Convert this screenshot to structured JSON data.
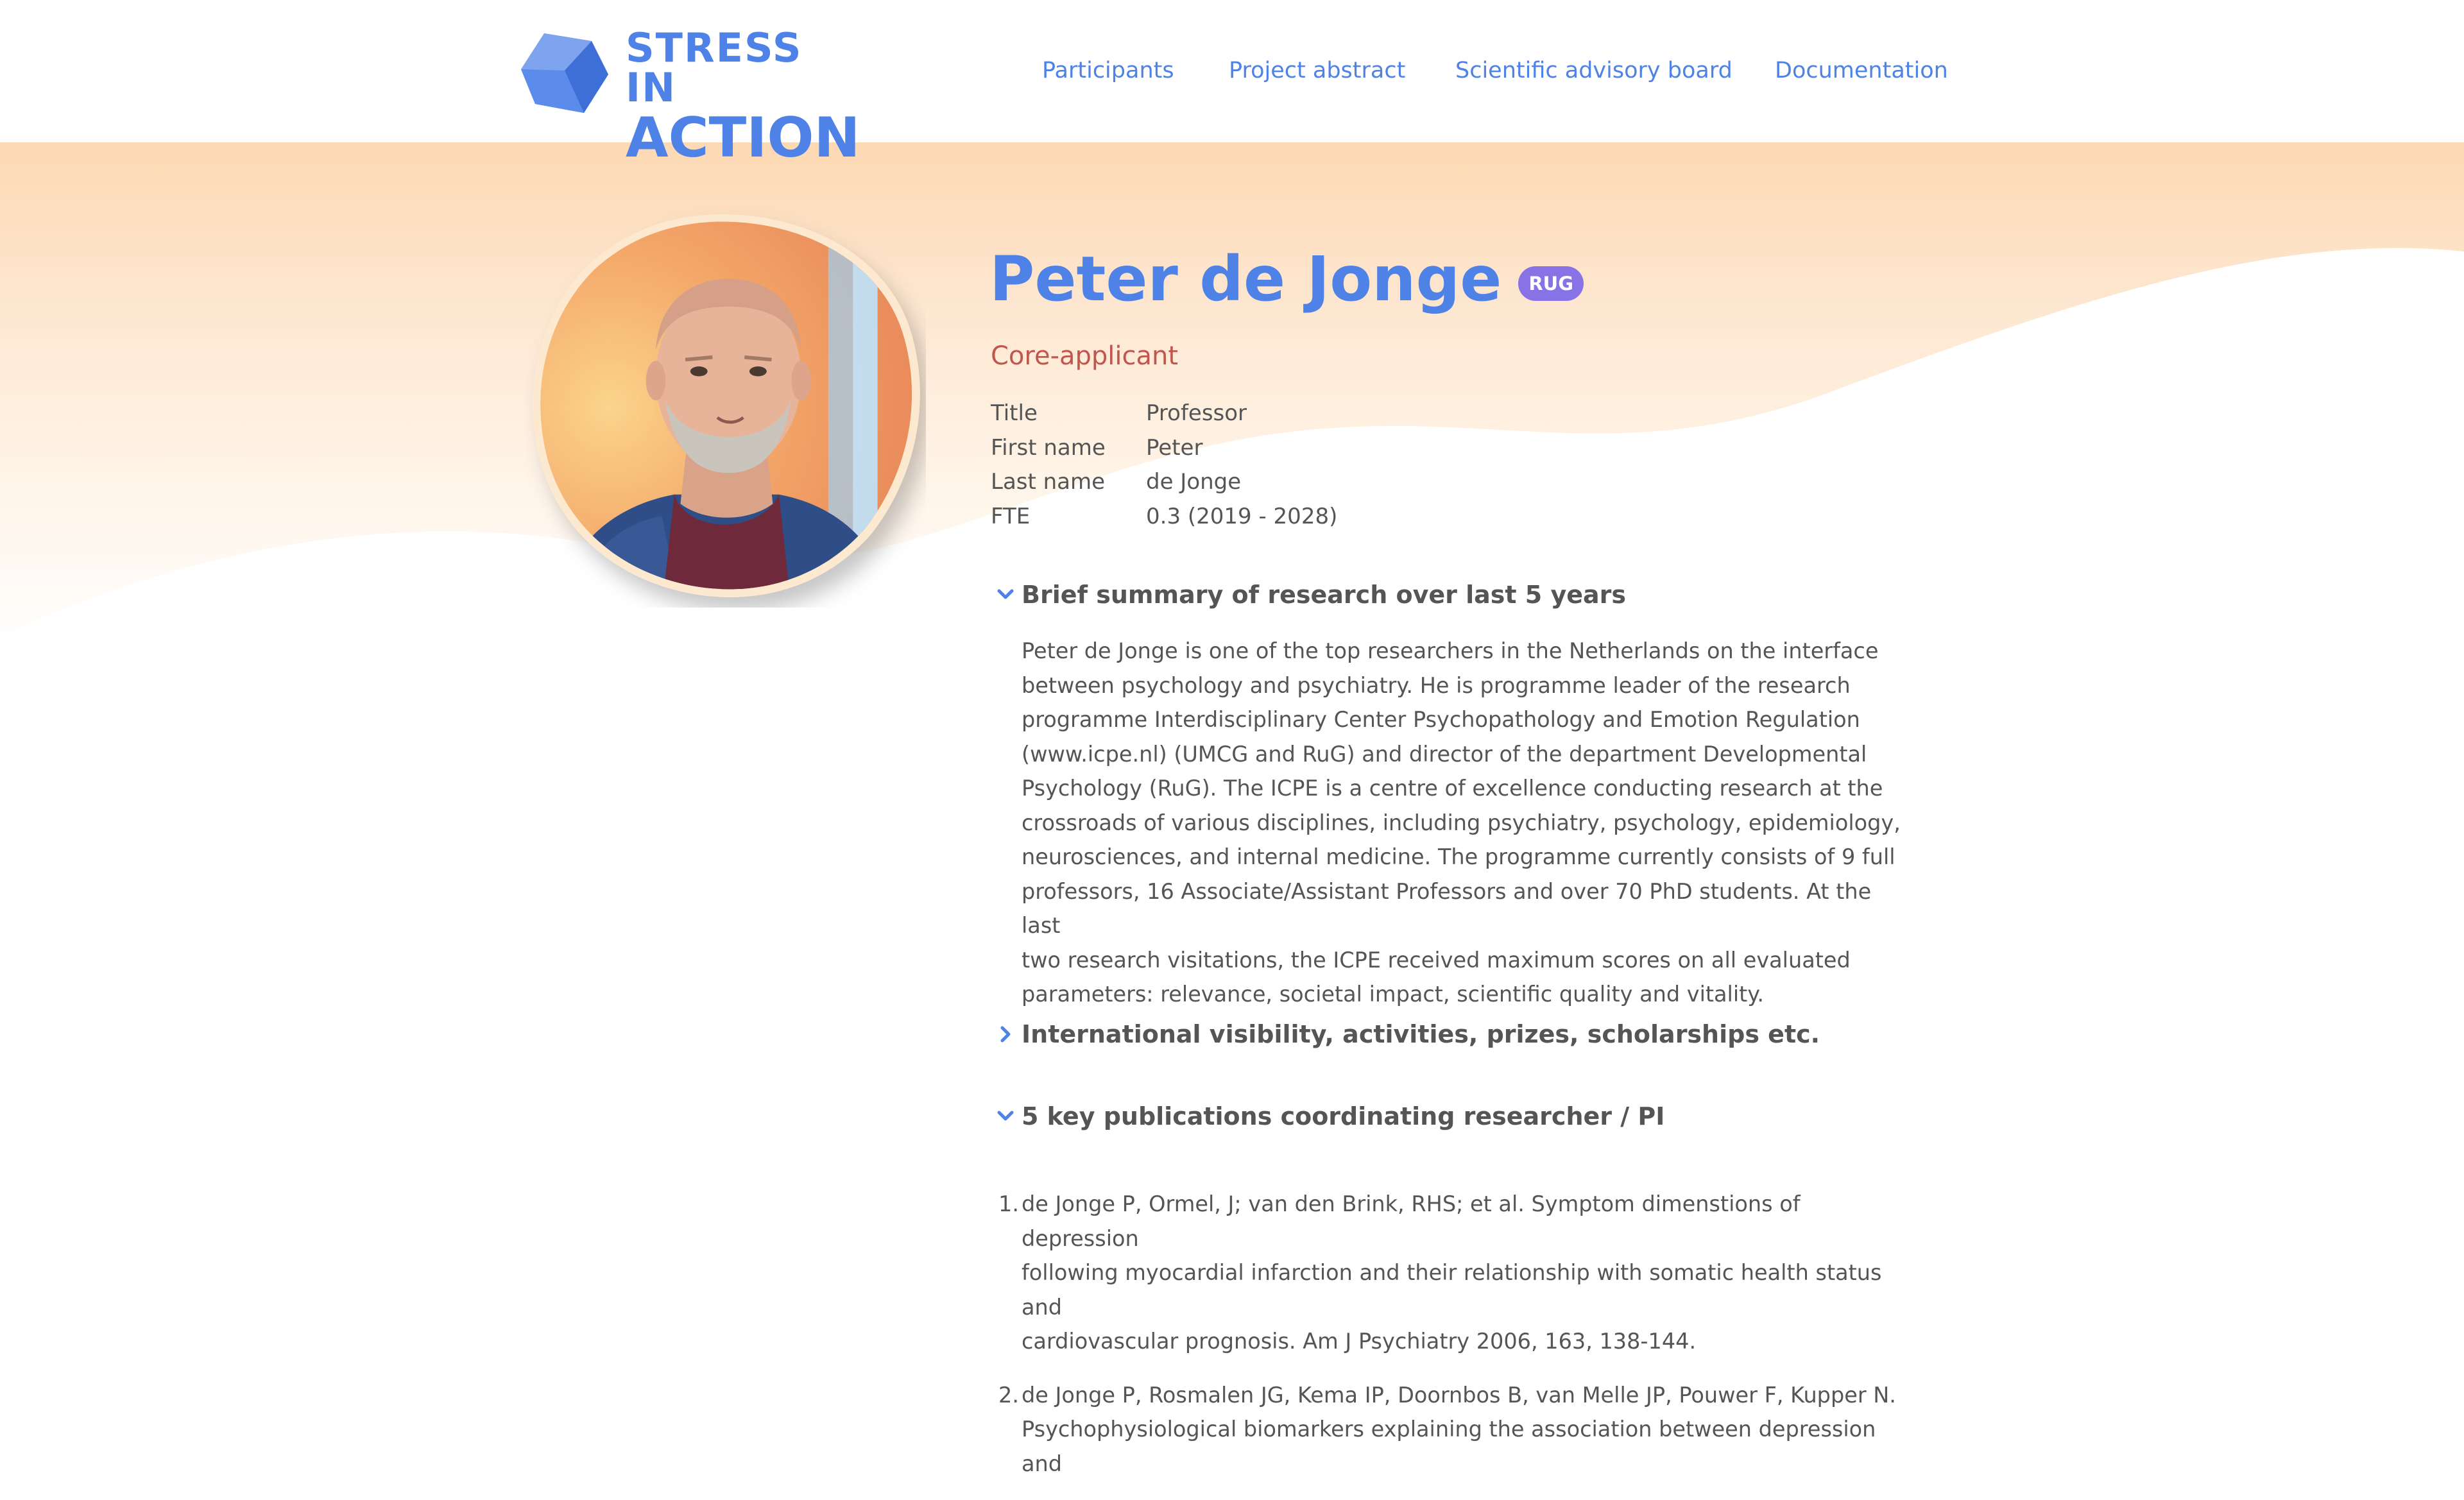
{
  "brand": {
    "line1": "STRESS IN",
    "line2": "ACTION",
    "color": "#4f82e6"
  },
  "nav": [
    {
      "label": "Participants"
    },
    {
      "label": "Project abstract"
    },
    {
      "label": "Scientific advisory board"
    },
    {
      "label": "Documentation"
    }
  ],
  "profile": {
    "name": "Peter de Jonge",
    "badge": "RUG",
    "role": "Core-applicant",
    "fields": [
      {
        "key": "Title",
        "value": "Professor"
      },
      {
        "key": "First name",
        "value": "Peter"
      },
      {
        "key": "Last name",
        "value": "de Jonge"
      },
      {
        "key": "FTE",
        "value": "0.3 (2019 - 2028)"
      }
    ]
  },
  "sections": [
    {
      "title": "Brief summary of research over last 5 years",
      "expanded": true,
      "lines": [
        "Peter de Jonge is one of the top researchers in the Netherlands on the interface",
        "between psychology and psychiatry. He is programme leader of the research",
        "programme Interdisciplinary Center Psychopathology and Emotion Regulation",
        "(www.icpe.nl) (UMCG and RuG) and director of the department Developmental",
        "Psychology (RuG). The ICPE is a centre of excellence conducting research at the",
        "crossroads of various disciplines, including psychiatry, psychology, epidemiology,",
        "neurosciences, and internal medicine. The programme currently consists of 9 full",
        "professors, 16 Associate/Assistant Professors and over 70 PhD students. At the last",
        "two research visitations, the ICPE received maximum scores on all evaluated",
        "parameters: relevance, societal impact, scientific quality and vitality."
      ]
    },
    {
      "title": "International visibility, activities, prizes, scholarships etc.",
      "expanded": false
    },
    {
      "title": "5 key publications coordinating researcher / PI",
      "expanded": true,
      "publications": [
        {
          "num": "1.",
          "lines": [
            "de Jonge P, Ormel, J; van den Brink, RHS; et al. Symptom dimenstions of depression",
            "following myocardial infarction and their relationship with somatic health status and",
            "cardiovascular prognosis. Am J Psychiatry 2006, 163, 138-144."
          ]
        },
        {
          "num": "2.",
          "lines": [
            "de Jonge P, Rosmalen JG, Kema IP, Doornbos B, van Melle JP, Pouwer F, Kupper N.",
            "Psychophysiological biomarkers explaining the association between depression and"
          ]
        }
      ]
    }
  ],
  "colors": {
    "accent": "#4f82e6",
    "badge": "#8873e6",
    "role": "#c0564d",
    "hero_top": "#fdd9b3"
  },
  "icons": {
    "logo": "gem-icon",
    "expanded": "chevron-down-icon",
    "collapsed": "chevron-right-icon"
  }
}
